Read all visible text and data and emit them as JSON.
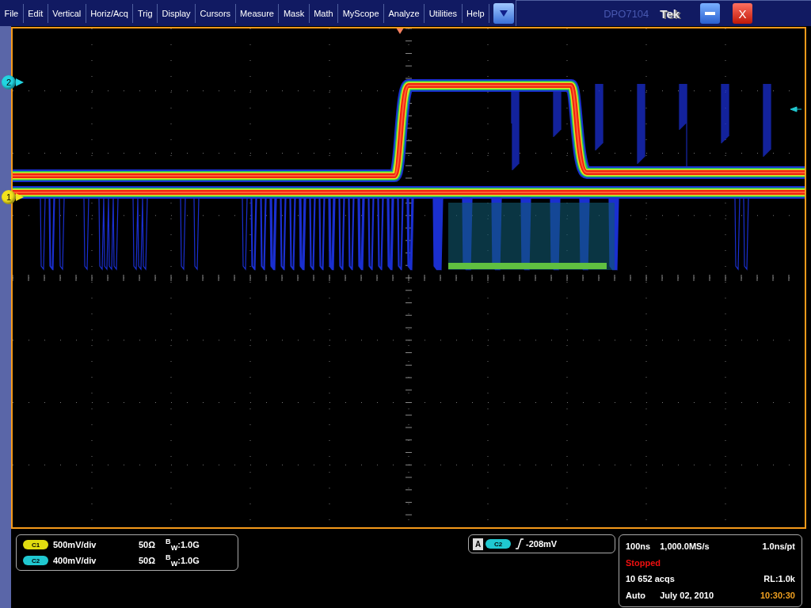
{
  "menu": [
    "File",
    "Edit",
    "Vertical",
    "Horiz/Acq",
    "Trig",
    "Display",
    "Cursors",
    "Measure",
    "Mask",
    "Math",
    "MyScope",
    "Analyze",
    "Utilities",
    "Help"
  ],
  "title": {
    "model": "DPO7104",
    "brand": "Tek",
    "close": "X"
  },
  "markers": [
    {
      "label": "2",
      "color": "#22d4e0",
      "kind": "c2"
    },
    {
      "label": "1",
      "color": "#f2e21c",
      "kind": "c1"
    }
  ],
  "vertical": [
    {
      "badge": "C1",
      "color": "#e0dc10",
      "scale": "500mV/div",
      "impedance": "50Ω",
      "bandwidth": "$^{B}$$_{W}$:1.0G"
    },
    {
      "badge": "C2",
      "color": "#20c8d0",
      "scale": "400mV/div",
      "impedance": "50Ω",
      "bandwidth": "$^{B}$$_{W}$:1.0G"
    }
  ],
  "trigger": {
    "source": "A",
    "badge": "C2",
    "color": "#20c8d0",
    "threshold": "-208mV"
  },
  "acquisition": {
    "timebase": "100ns",
    "sample_rate": "1,000.0MS/s",
    "resolution": "1.0ns/pt",
    "state": "Stopped",
    "count": "10 652 acqs",
    "record_length": "RL:1.0k",
    "mode": "Auto",
    "date": "July 02, 2010",
    "time": "10:30:30"
  }
}
